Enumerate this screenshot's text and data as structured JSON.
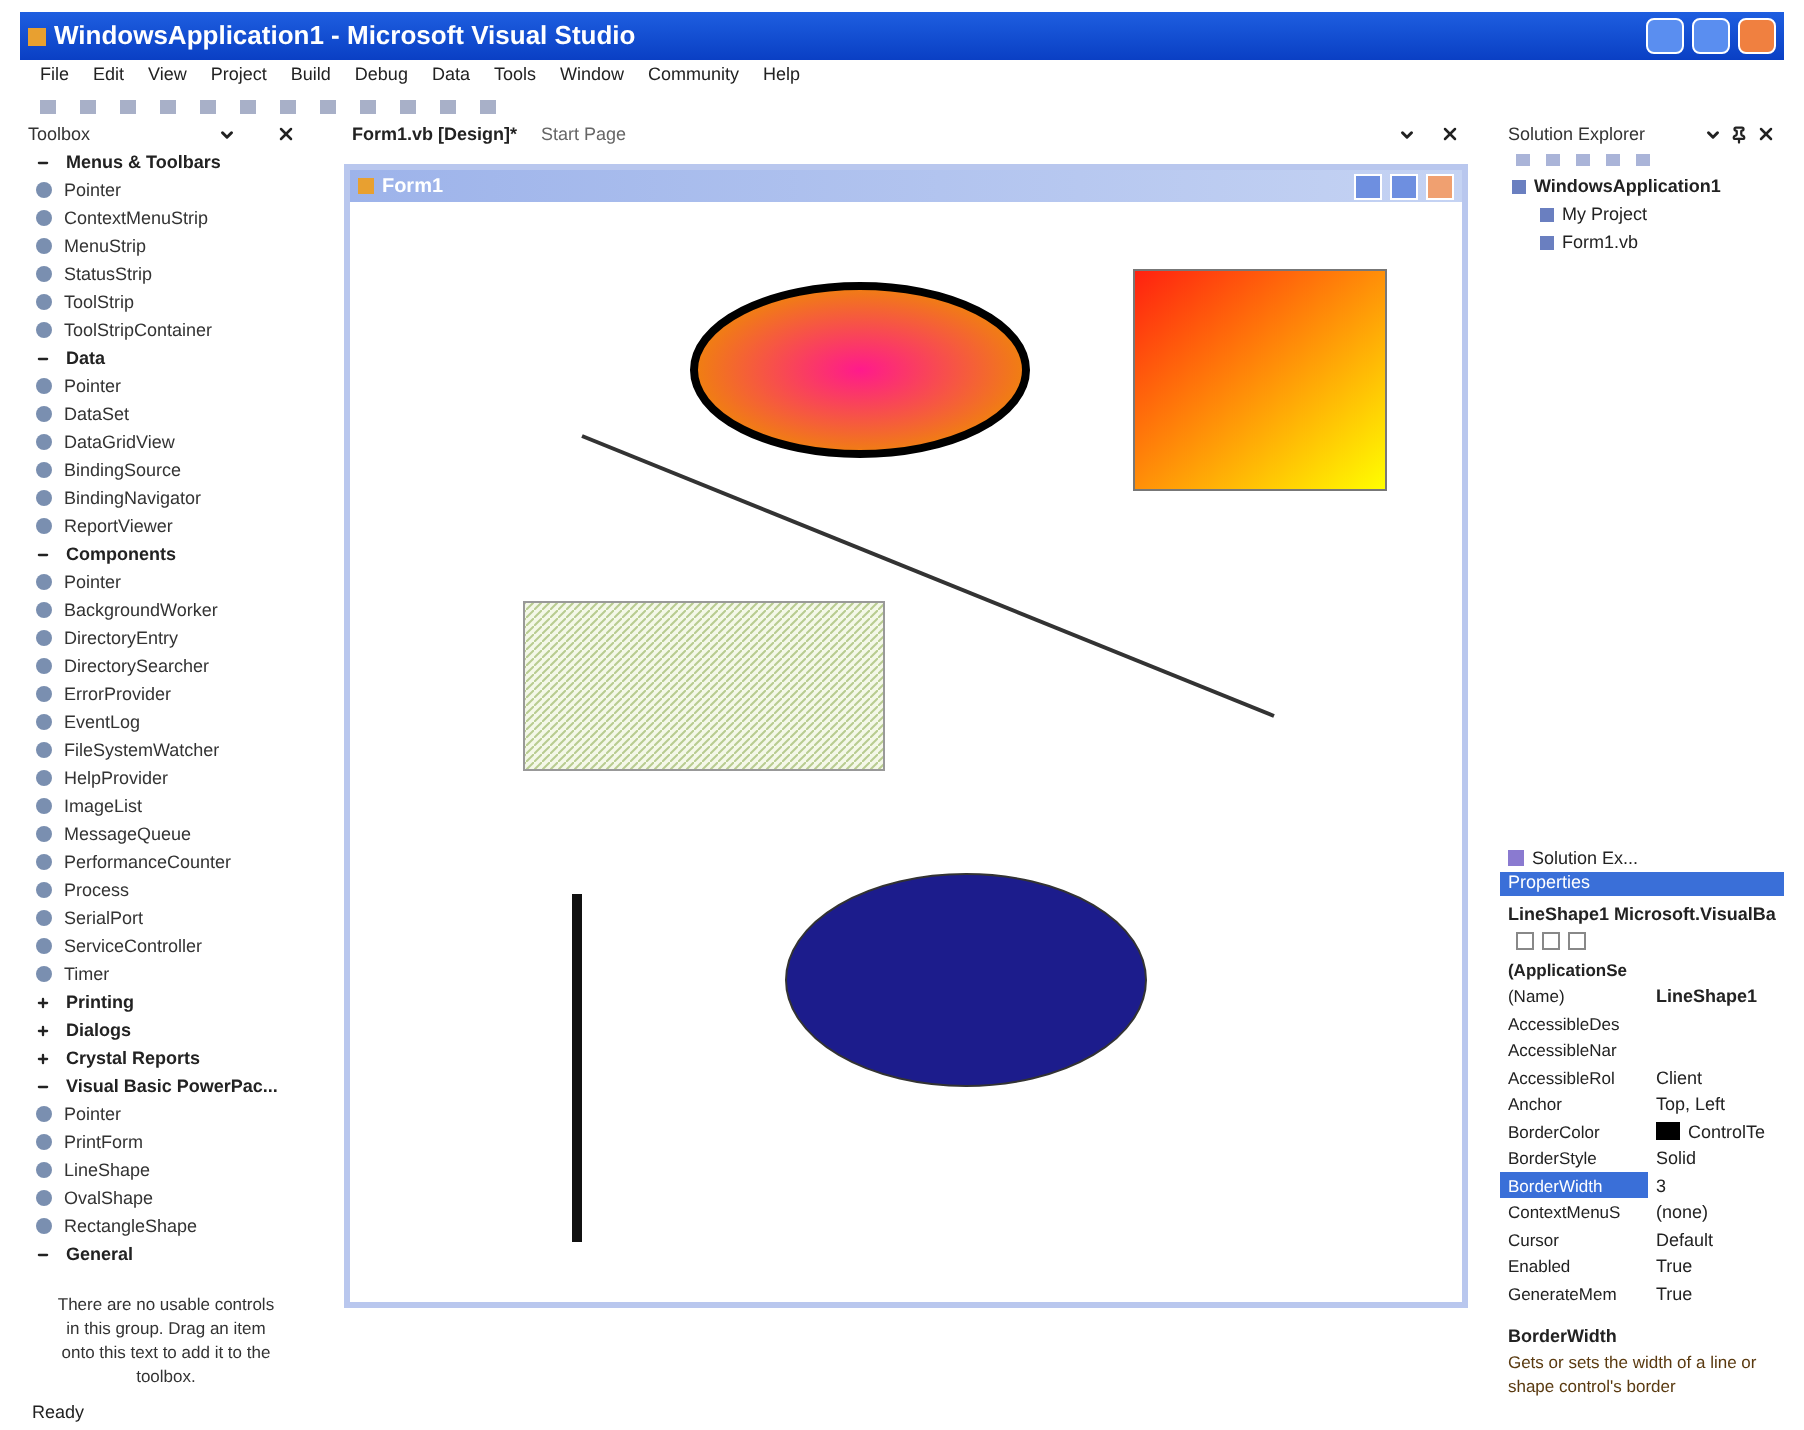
{
  "window": {
    "title": "WindowsApplication1 - Microsoft Visual Studio"
  },
  "menu": [
    "File",
    "Edit",
    "View",
    "Project",
    "Build",
    "Debug",
    "Data",
    "Tools",
    "Window",
    "Community",
    "Help"
  ],
  "toolbox": {
    "title": "Toolbox",
    "groups": [
      {
        "label": "Menus & Toolbars",
        "expanded": true,
        "items": [
          "Pointer",
          "ContextMenuStrip",
          "MenuStrip",
          "StatusStrip",
          "ToolStrip",
          "ToolStripContainer"
        ]
      },
      {
        "label": "Data",
        "expanded": true,
        "items": [
          "Pointer",
          "DataSet",
          "DataGridView",
          "BindingSource",
          "BindingNavigator",
          "ReportViewer"
        ]
      },
      {
        "label": "Components",
        "expanded": true,
        "items": [
          "Pointer",
          "BackgroundWorker",
          "DirectoryEntry",
          "DirectorySearcher",
          "ErrorProvider",
          "EventLog",
          "FileSystemWatcher",
          "HelpProvider",
          "ImageList",
          "MessageQueue",
          "PerformanceCounter",
          "Process",
          "SerialPort",
          "ServiceController",
          "Timer"
        ]
      },
      {
        "label": "Printing",
        "expanded": false
      },
      {
        "label": "Dialogs",
        "expanded": false
      },
      {
        "label": "Crystal Reports",
        "expanded": false
      },
      {
        "label": "Visual Basic PowerPac...",
        "expanded": true,
        "items": [
          "Pointer",
          "PrintForm",
          "LineShape",
          "OvalShape",
          "RectangleShape"
        ]
      },
      {
        "label": "General",
        "expanded": true
      }
    ],
    "empty_message": "There are no usable controls in this group. Drag an item onto this text to add it to the toolbox."
  },
  "doc_tabs": [
    {
      "label": "Form1.vb [Design]*",
      "selected": true
    },
    {
      "label": "Start Page",
      "selected": false
    }
  ],
  "form": {
    "title": "Form1"
  },
  "solution_explorer": {
    "title": "Solution Explorer",
    "tree": [
      {
        "label": "WindowsApplication1",
        "children": [
          {
            "label": "My Project"
          },
          {
            "label": "Form1.vb"
          }
        ]
      }
    ],
    "tab": "Solution Ex..."
  },
  "properties": {
    "title": "Properties",
    "object": "LineShape1 Microsoft.VisualBa",
    "rows": [
      {
        "kind": "category",
        "name": "(ApplicationSe",
        "selected": false
      },
      {
        "kind": "prop",
        "name": "(Name)",
        "value": "LineShape1",
        "selected": false
      },
      {
        "kind": "prop",
        "name": "AccessibleDes",
        "selected": false
      },
      {
        "kind": "prop",
        "name": "AccessibleNar",
        "selected": false
      },
      {
        "kind": "prop",
        "name": "AccessibleRol",
        "value": "Client",
        "selected": false
      },
      {
        "kind": "prop",
        "name": "Anchor",
        "value": "Top, Left",
        "selected": false
      },
      {
        "kind": "color",
        "name": "BorderColor",
        "value": "ControlTe",
        "selected": false,
        "color": "#000000"
      },
      {
        "kind": "prop",
        "name": "BorderStyle",
        "value": "Solid",
        "selected": false
      },
      {
        "kind": "prop",
        "name": "BorderWidth",
        "value": "3",
        "selected": true
      },
      {
        "kind": "prop",
        "name": "ContextMenuS",
        "value": "(none)",
        "selected": false
      },
      {
        "kind": "prop",
        "name": "Cursor",
        "value": "Default",
        "selected": false
      },
      {
        "kind": "prop",
        "name": "Enabled",
        "value": "True",
        "selected": false
      },
      {
        "kind": "prop",
        "name": "GenerateMem",
        "value": "True",
        "selected": false
      }
    ],
    "help_title": "BorderWidth",
    "help_text": "Gets or sets the width of a line or shape control's border"
  },
  "status_bar": "Ready"
}
